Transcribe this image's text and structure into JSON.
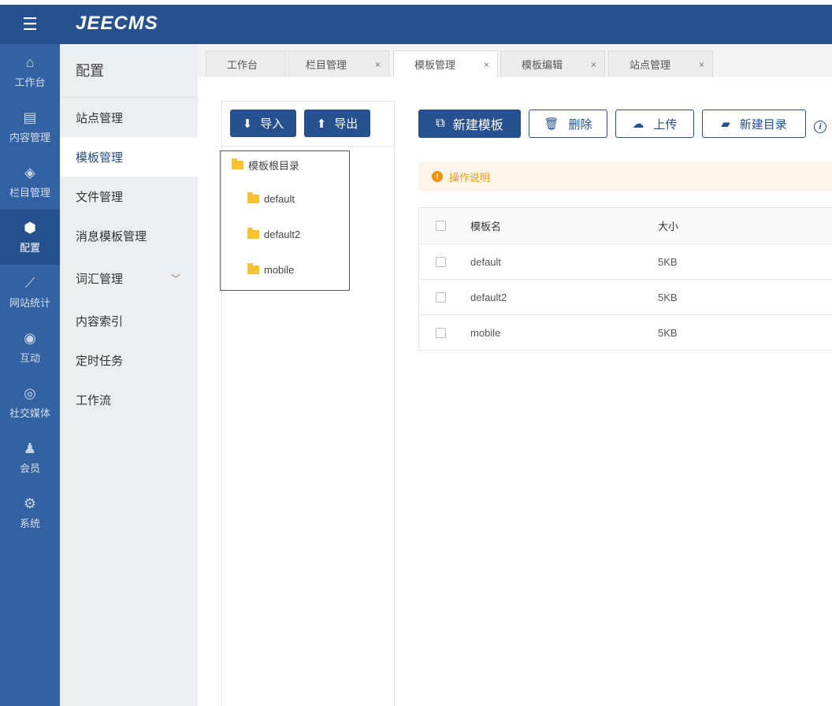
{
  "header": {
    "logo": "JEECMS",
    "menu_icon": "hamburger-icon"
  },
  "sidebar": {
    "items": [
      {
        "label": "工作台",
        "icon": "⌂"
      },
      {
        "label": "内容管理",
        "icon": "▤"
      },
      {
        "label": "栏目管理",
        "icon": "◈"
      },
      {
        "label": "配置",
        "icon": "⬢",
        "active": true
      },
      {
        "label": "网站统计",
        "icon": "⟋"
      },
      {
        "label": "互动",
        "icon": "◉"
      },
      {
        "label": "社交媒体",
        "icon": "◎"
      },
      {
        "label": "会员",
        "icon": "♟"
      },
      {
        "label": "系统",
        "icon": "⚙"
      }
    ]
  },
  "submenu": {
    "title": "配置",
    "items": [
      {
        "label": "站点管理"
      },
      {
        "label": "模板管理",
        "active": true
      },
      {
        "label": "文件管理"
      },
      {
        "label": "消息模板管理"
      },
      {
        "label": "词汇管理",
        "expandable": true
      },
      {
        "label": "内容索引"
      },
      {
        "label": "定时任务"
      },
      {
        "label": "工作流"
      }
    ]
  },
  "tabs": [
    {
      "label": "工作台",
      "closable": false
    },
    {
      "label": "栏目管理",
      "closable": true
    },
    {
      "label": "模板管理",
      "closable": true,
      "active": true
    },
    {
      "label": "模板编辑",
      "closable": true
    },
    {
      "label": "站点管理",
      "closable": true
    }
  ],
  "tree": {
    "import": "导入",
    "export": "导出",
    "root": "模板根目录",
    "children": [
      "default",
      "default2",
      "mobile"
    ]
  },
  "toolbar": {
    "new_template": "新建模板",
    "delete": "删除",
    "upload": "上传",
    "new_dir": "新建目录"
  },
  "notice": "操作说明",
  "table": {
    "headers": [
      "模板名",
      "大小"
    ],
    "rows": [
      [
        "default",
        "5KB"
      ],
      [
        "default2",
        "5KB"
      ],
      [
        "mobile",
        "5KB"
      ]
    ]
  },
  "colors": {
    "primary": "#27508e",
    "sidebar": "#3362a3",
    "warning": "#f39200",
    "folder": "#f7c32e"
  }
}
